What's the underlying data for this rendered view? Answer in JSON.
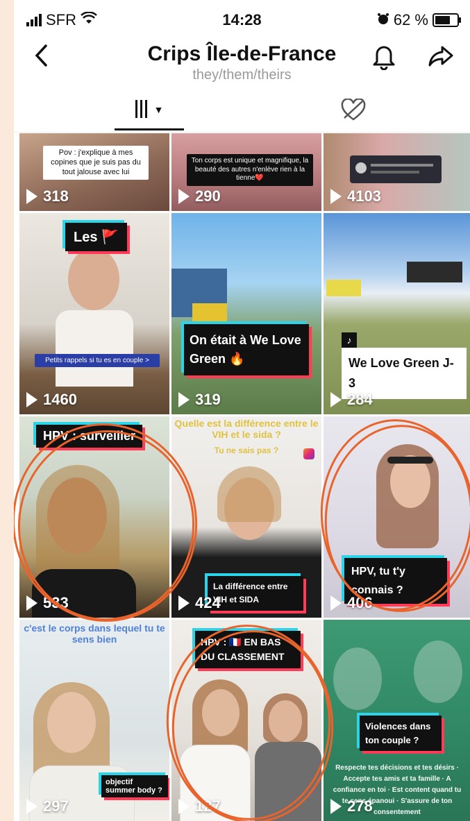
{
  "status_bar": {
    "carrier": "SFR",
    "time": "14:28",
    "battery": "62 %"
  },
  "header": {
    "title": "Crips Île-de-France",
    "pronouns": "they/them/theirs"
  },
  "videos": [
    {
      "views": "318",
      "caption": "Pov : j'explique à mes copines que je suis pas du tout jalouse avec lui"
    },
    {
      "views": "290",
      "caption": "Ton corps est unique et magnifique, la beauté des autres n'enlève rien à la tienne❤️"
    },
    {
      "views": "4103",
      "caption": ""
    },
    {
      "views": "1460",
      "caption": "Les 🚩",
      "subcaption": "Petits rappels si tu es en couple >"
    },
    {
      "views": "319",
      "caption": "On était à We Love Green 🔥"
    },
    {
      "views": "284",
      "caption": "We Love Green J-3"
    },
    {
      "views": "533",
      "caption": "HPV : surveiller"
    },
    {
      "views": "424",
      "caption": "La différence entre VIH et SIDA",
      "top_text": "Quelle est la différence entre le VIH et le sida ?",
      "top_text2": "Tu ne sais pas ?"
    },
    {
      "views": "406",
      "caption": "HPV, tu t'y connais ?"
    },
    {
      "views": "297",
      "caption": "objectif summer body ?",
      "top_text": "c'est le corps dans lequel tu te sens bien"
    },
    {
      "views": "127",
      "caption": "HPV : 🇫🇷 EN BAS DU CLASSEMENT"
    },
    {
      "views": "278",
      "caption": "Violences dans ton couple ?",
      "overlay": "Respecte tes décisions et tes désirs · Accepte tes amis et ta famille · A confiance en toi · Est content quand tu te sens épanoui · S'assure de ton consentement"
    }
  ],
  "colors": {
    "accent_ring": "#e8642c",
    "caption_cyan": "#2bd4e8",
    "caption_red": "#ff3b58",
    "page_bg": "#fbeadb"
  }
}
